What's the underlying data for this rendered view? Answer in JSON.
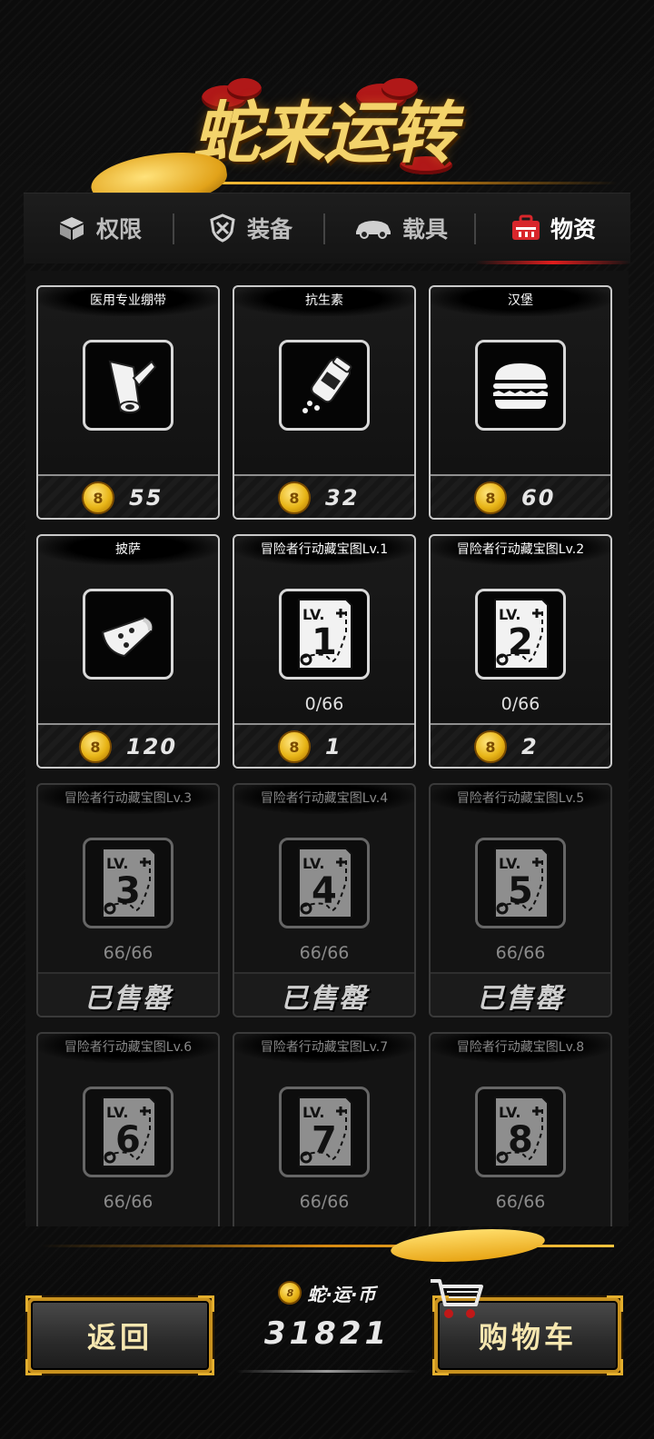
{
  "title": "蛇来运转",
  "tabs": [
    {
      "label": "权限",
      "icon": "box-icon",
      "active": false
    },
    {
      "label": "装备",
      "icon": "shield-icon",
      "active": false
    },
    {
      "label": "载具",
      "icon": "car-icon",
      "active": false
    },
    {
      "label": "物资",
      "icon": "medkit-icon",
      "active": true
    }
  ],
  "items": [
    {
      "name": "医用专业绷带",
      "icon": "bandage-icon",
      "price": "55",
      "stock": "",
      "sold_out": false
    },
    {
      "name": "抗生素",
      "icon": "pill-bottle-icon",
      "price": "32",
      "stock": "",
      "sold_out": false
    },
    {
      "name": "汉堡",
      "icon": "burger-icon",
      "price": "60",
      "stock": "",
      "sold_out": false
    },
    {
      "name": "披萨",
      "icon": "pizza-icon",
      "price": "120",
      "stock": "",
      "sold_out": false
    },
    {
      "name": "冒险者行动藏宝图Lv.1",
      "icon": "treasure-map-icon",
      "level": "1",
      "price": "1",
      "stock": "0/66",
      "sold_out": false
    },
    {
      "name": "冒险者行动藏宝图Lv.2",
      "icon": "treasure-map-icon",
      "level": "2",
      "price": "2",
      "stock": "0/66",
      "sold_out": false
    },
    {
      "name": "冒险者行动藏宝图Lv.3",
      "icon": "treasure-map-icon",
      "level": "3",
      "price": "",
      "stock": "66/66",
      "sold_out": true
    },
    {
      "name": "冒险者行动藏宝图Lv.4",
      "icon": "treasure-map-icon",
      "level": "4",
      "price": "",
      "stock": "66/66",
      "sold_out": true
    },
    {
      "name": "冒险者行动藏宝图Lv.5",
      "icon": "treasure-map-icon",
      "level": "5",
      "price": "",
      "stock": "66/66",
      "sold_out": true
    },
    {
      "name": "冒险者行动藏宝图Lv.6",
      "icon": "treasure-map-icon",
      "level": "6",
      "price": "",
      "stock": "66/66",
      "sold_out": true
    },
    {
      "name": "冒险者行动藏宝图Lv.7",
      "icon": "treasure-map-icon",
      "level": "7",
      "price": "",
      "stock": "66/66",
      "sold_out": true
    },
    {
      "name": "冒险者行动藏宝图Lv.8",
      "icon": "treasure-map-icon",
      "level": "8",
      "price": "",
      "stock": "66/66",
      "sold_out": true
    }
  ],
  "sold_out_label": "已售罄",
  "map_level_prefix": "LV.",
  "currency": {
    "label": "蛇·运·币",
    "value": "31821",
    "icon": "coin-icon"
  },
  "buttons": {
    "back": "返回",
    "cart": "购物车"
  },
  "colors": {
    "accent_gold": "#f3d36b",
    "active_tab_red": "#e01d1d",
    "card_border": "#c9c9c9"
  }
}
